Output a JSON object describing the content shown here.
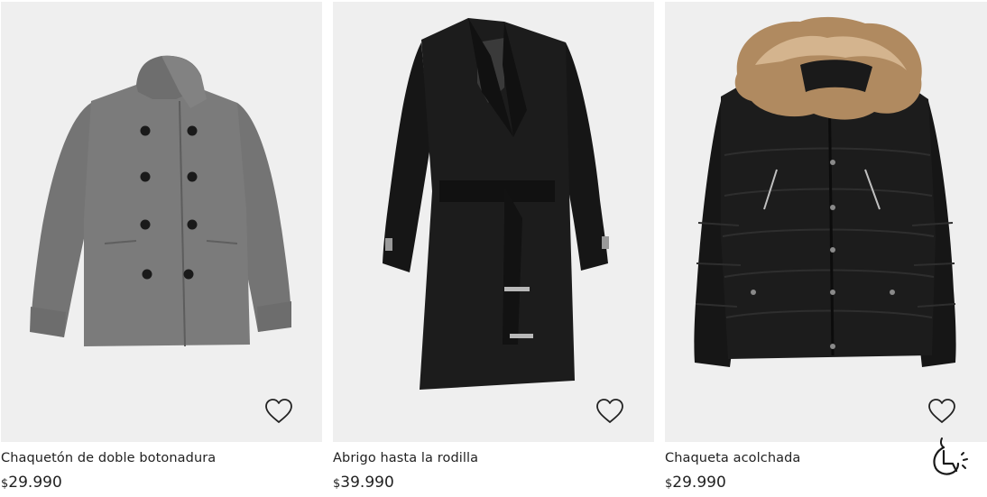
{
  "products": [
    {
      "name": "Chaquetón de doble botonadura",
      "currency": "$",
      "price": "29.990",
      "image_icon": "grey-double-breasted-coat-image",
      "favorite_icon": "heart-outline-icon"
    },
    {
      "name": "Abrigo hasta la rodilla",
      "currency": "$",
      "price": "39.990",
      "image_icon": "black-knee-length-coat-image",
      "favorite_icon": "heart-outline-icon"
    },
    {
      "name": "Chaqueta acolchada",
      "currency": "$",
      "price": "29.990",
      "image_icon": "black-padded-jacket-image",
      "favorite_icon": "heart-outline-icon"
    }
  ],
  "assistant_icon": "accessibility-assistant-icon",
  "colors": {
    "image_background": "#efefef",
    "text": "#222222",
    "grey_coat": "#7b7b7b",
    "black_garment": "#1c1c1c",
    "fur": "#b08a60"
  }
}
